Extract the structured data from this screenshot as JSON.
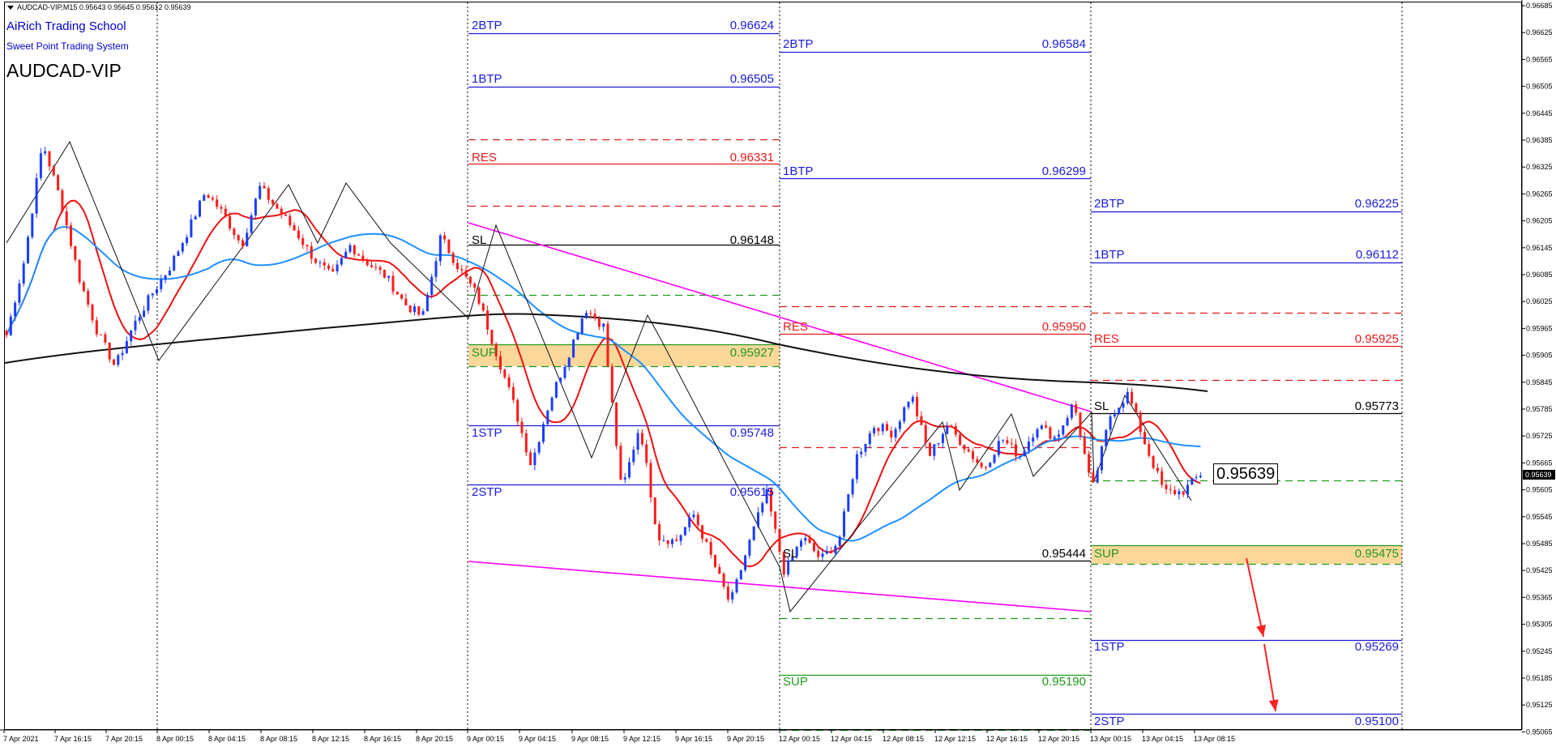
{
  "window": {
    "ohlc_text": "AUDCAD-VIP,M15  0.95643 0.95645 0.95612 0.95639",
    "school": "AiRich Trading School",
    "system": "Sweet Point Trading System",
    "symbol": "AUDCAD-VIP",
    "current_price": "0.95639",
    "current_price_axis": "0.95639"
  },
  "colors": {
    "background": "#ffffff",
    "bull_candle": "#1a3cff",
    "bear_candle": "#ff1a1a",
    "ma_fast": "#ee1111",
    "ma_mid": "#1e90ff",
    "ma_slow": "#111111",
    "trendline": "#ff00ff",
    "btp_stp": "#1c1cd9",
    "res": "#e31b1b",
    "sup": "#1f9a1f",
    "sup_zone": "#fbd79a",
    "arrow": "#ff2020"
  },
  "price_axis": {
    "labels": [
      "0.96685",
      "0.96625",
      "0.96565",
      "0.96505",
      "0.96445",
      "0.96385",
      "0.96325",
      "0.96265",
      "0.96205",
      "0.96145",
      "0.96085",
      "0.96025",
      "0.95965",
      "0.95905",
      "0.95845",
      "0.95785",
      "0.95725",
      "0.95665",
      "0.95605",
      "0.95545",
      "0.95485",
      "0.95425",
      "0.95365",
      "0.95305",
      "0.95245",
      "0.95185",
      "0.95125",
      "0.95065"
    ]
  },
  "time_axis": {
    "labels": [
      "7 Apr 2021",
      "7 Apr 16:15",
      "7 Apr 20:15",
      "8 Apr 00:15",
      "8 Apr 04:15",
      "8 Apr 08:15",
      "8 Apr 12:15",
      "8 Apr 16:15",
      "8 Apr 20:15",
      "9 Apr 00:15",
      "9 Apr 04:15",
      "9 Apr 08:15",
      "9 Apr 12:15",
      "9 Apr 16:15",
      "9 Apr 20:15",
      "12 Apr 00:15",
      "12 Apr 04:15",
      "12 Apr 08:15",
      "12 Apr 12:15",
      "12 Apr 16:15",
      "12 Apr 20:15",
      "13 Apr 00:15",
      "13 Apr 04:15",
      "13 Apr 08:15"
    ]
  },
  "level_labels": [
    {
      "name": "2BTP",
      "value": "0.96624",
      "color": "btp"
    },
    {
      "name": "1BTP",
      "value": "0.96505",
      "color": "btp"
    },
    {
      "name": "RES",
      "value": "0.96331",
      "color": "res"
    },
    {
      "name": "SL",
      "value": "0.96148",
      "color": "sl"
    },
    {
      "name": "SUP",
      "value": "0.95927",
      "color": "sup"
    },
    {
      "name": "1STP",
      "value": "0.95748",
      "color": "btp"
    },
    {
      "name": "2STP",
      "value": "0.95615",
      "color": "btp"
    },
    {
      "name": "2BTP",
      "value": "0.96584",
      "color": "btp"
    },
    {
      "name": "1BTP",
      "value": "0.96299",
      "color": "btp"
    },
    {
      "name": "RES",
      "value": "0.95950",
      "color": "res"
    },
    {
      "name": "SL",
      "value": "0.95444",
      "color": "sl"
    },
    {
      "name": "SUP",
      "value": "0.95190",
      "color": "sup"
    },
    {
      "name": "2BTP",
      "value": "0.96225",
      "color": "btp"
    },
    {
      "name": "1BTP",
      "value": "0.96112",
      "color": "btp"
    },
    {
      "name": "RES",
      "value": "0.95925",
      "color": "res"
    },
    {
      "name": "SL",
      "value": "0.95773",
      "color": "sl"
    },
    {
      "name": "SUP",
      "value": "0.95475",
      "color": "sup"
    },
    {
      "name": "1STP",
      "value": "0.95269",
      "color": "btp"
    },
    {
      "name": "2STP",
      "value": "0.95100",
      "color": "btp"
    }
  ],
  "chart_data": {
    "type": "candlestick",
    "symbol": "AUDCAD-VIP",
    "timeframe": "M15",
    "ylim": [
      0.95065,
      0.96685
    ],
    "grid": false,
    "close_path": [
      0.9595,
      0.9612,
      0.9638,
      0.9625,
      0.9608,
      0.9596,
      0.9588,
      0.9597,
      0.9604,
      0.961,
      0.9618,
      0.9627,
      0.9622,
      0.9615,
      0.9628,
      0.9623,
      0.9618,
      0.9612,
      0.9608,
      0.9615,
      0.9611,
      0.9608,
      0.9602,
      0.9599,
      0.9617,
      0.961,
      0.9604,
      0.9592,
      0.958,
      0.9566,
      0.958,
      0.959,
      0.9601,
      0.9597,
      0.956,
      0.9575,
      0.955,
      0.9549,
      0.9555,
      0.9545,
      0.9535,
      0.9548,
      0.956,
      0.9542,
      0.955,
      0.9545,
      0.9549,
      0.9568,
      0.9575,
      0.9573,
      0.9582,
      0.9568,
      0.9575,
      0.957,
      0.9565,
      0.9572,
      0.9568,
      0.9575,
      0.9572,
      0.958,
      0.956,
      0.9577,
      0.9582,
      0.957,
      0.956,
      0.956,
      0.9564
    ]
  }
}
